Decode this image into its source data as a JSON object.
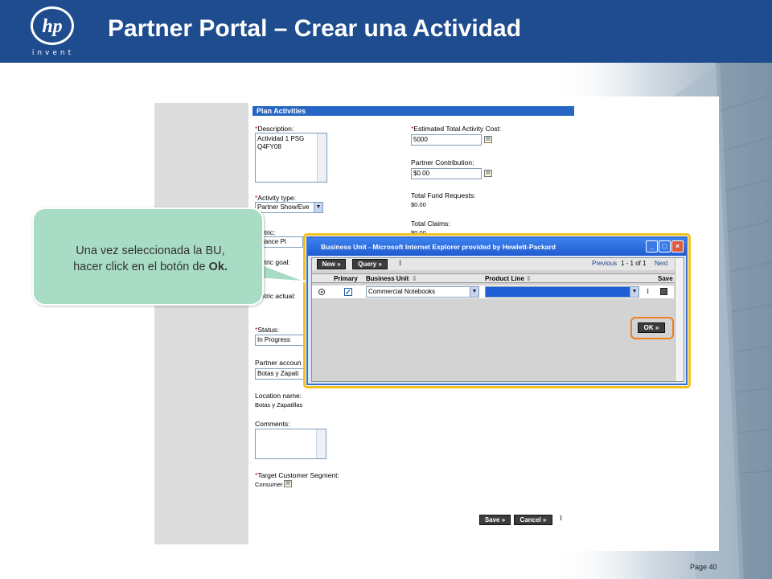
{
  "header": {
    "title": "Partner Portal – Crear una Actividad",
    "logo_text": "hp",
    "logo_tagline": "invent"
  },
  "form": {
    "section_title": "Plan Activities",
    "description_label": "Description:",
    "description_value_line1": "Actividad 1 PSG",
    "description_value_line2": "Q4FY08",
    "estimated_cost_label": "Estimated Total Activity Cost:",
    "estimated_cost_value": "5000",
    "partner_contribution_label": "Partner Contribution:",
    "partner_contribution_value": "$0.00",
    "activity_type_label": "Activity type:",
    "activity_type_value": "Partner Show/Eve",
    "total_fund_requests_label": "Total Fund Requests:",
    "total_fund_requests_value": "$0.00",
    "total_claims_label": "Total Claims:",
    "total_claims_value": "$0.00",
    "metric_label": "etric:",
    "metric_value": "ndance Pl",
    "metric_goal_label": "etric goal:",
    "metric_actual_label": "etric actual:",
    "status_label": "Status:",
    "status_value": "In Progress",
    "partner_account_label": "Partner accoun",
    "partner_account_value": "Botas y Zapati",
    "location_name_label": "Location name:",
    "location_name_value": "Botas y Zapatillas",
    "comments_label": "Comments:",
    "target_segment_label": "Target Customer Segment:",
    "target_segment_value": "Consumer",
    "save_button": "Save »",
    "cancel_button": "Cancel »"
  },
  "popup": {
    "title": "Business Unit - Microsoft Internet Explorer provided by Hewlett-Packard",
    "new_button": "New »",
    "query_button": "Query »",
    "previous_link": "Previous",
    "pager_text": "1 - 1 of 1",
    "next_link": "Next",
    "columns": {
      "primary": "Primary",
      "business_unit": "Business Unit",
      "product_line": "Product Line",
      "save": "Save"
    },
    "row": {
      "business_unit_value": "Commercial Notebooks",
      "product_line_value": ""
    },
    "ok_button": "OK »"
  },
  "callout": {
    "text_line1": "Una vez seleccionada la BU,",
    "text_line2_prefix": "hacer click en el botón de ",
    "text_line2_bold": "Ok."
  },
  "footer": {
    "page_label": "Page 40"
  },
  "colors": {
    "header_blue": "#1e4c8e",
    "callout_green": "#a9dcc5",
    "highlight_yellow": "#f3c01b",
    "highlight_orange": "#f07f1e"
  }
}
